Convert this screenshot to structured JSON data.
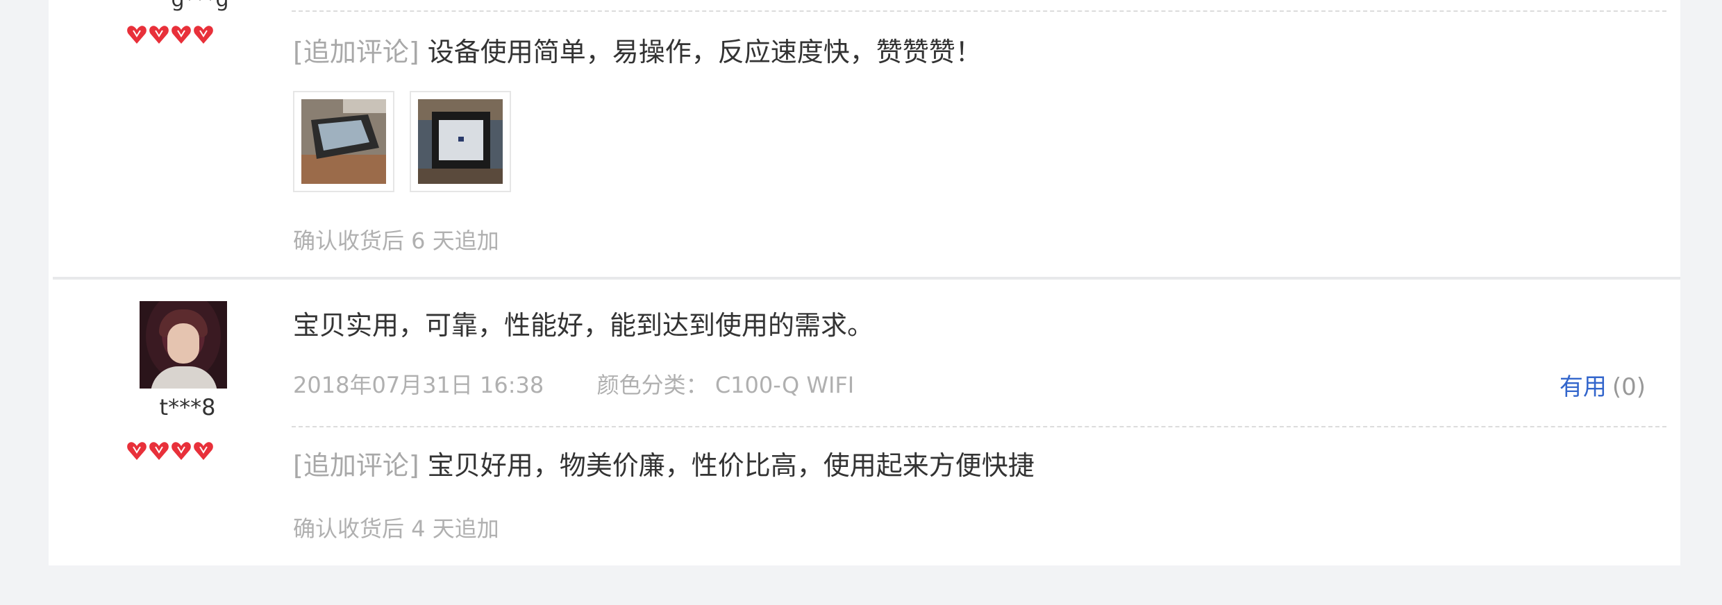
{
  "reviews": [
    {
      "username": "g***g",
      "rating_hearts": 4,
      "followup": {
        "tag": "[追加评论]",
        "text": "设备使用简单，易操作，反应速度快，赞赞赞！",
        "images": [
          "product-photo-1",
          "product-photo-2"
        ],
        "note": "确认收货后 6 天追加"
      }
    },
    {
      "username": "t***8",
      "rating_hearts": 4,
      "text": "宝贝实用，可靠，性能好，能到达到使用的需求。",
      "date": "2018年07月31日 16:38",
      "variant_label": "颜色分类：",
      "variant_value": "C100-Q WIFI",
      "helpful_label": "有用",
      "helpful_count": "(0)",
      "followup": {
        "tag": "[追加评论]",
        "text": "宝贝好用，物美价廉，性价比高，使用起来方便快捷",
        "note": "确认收货后 4 天追加"
      }
    }
  ],
  "colors": {
    "heart": "#e8303a",
    "link": "#3366cc",
    "muted": "#b0b0b0",
    "background": "#f2f3f5"
  }
}
